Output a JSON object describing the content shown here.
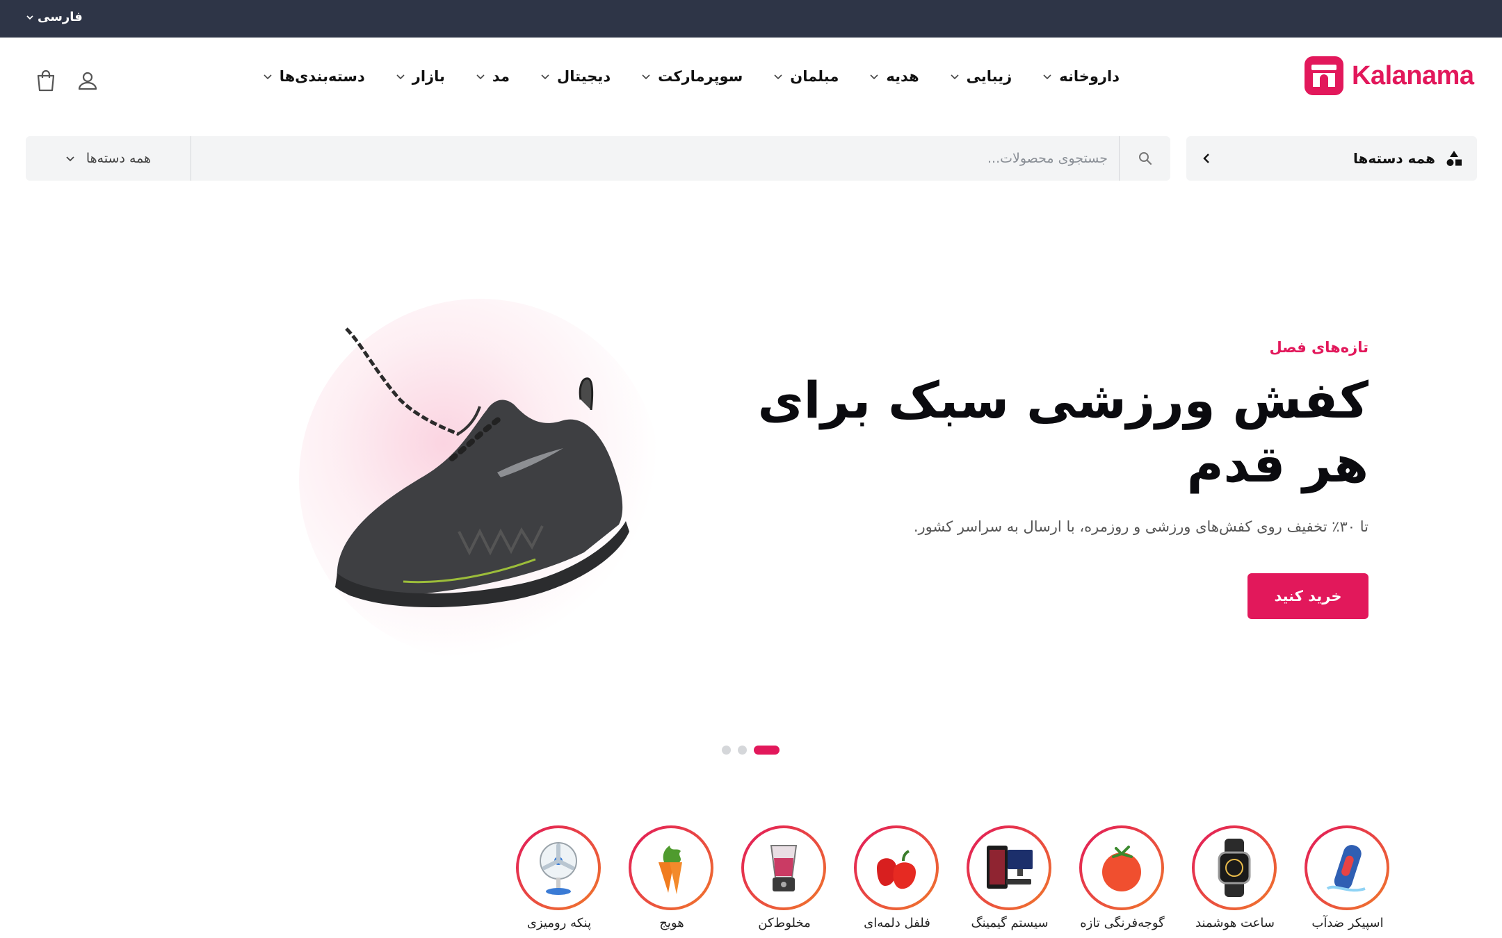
{
  "topbar": {
    "language": "فارسی"
  },
  "brand": {
    "name": "Kalanama",
    "color": "#e2185b"
  },
  "nav": {
    "items": [
      {
        "label": "دسته‌بندی‌ها"
      },
      {
        "label": "بازار"
      },
      {
        "label": "مد"
      },
      {
        "label": "دیجیتال"
      },
      {
        "label": "سوپرمارکت"
      },
      {
        "label": "مبلمان"
      },
      {
        "label": "هدیه"
      },
      {
        "label": "زیبایی"
      },
      {
        "label": "داروخانه"
      }
    ]
  },
  "header_icons": {
    "account": "user-icon",
    "cart": "shopping-bag-icon"
  },
  "search": {
    "all_categories_label": "همه دسته‌ها",
    "placeholder": "جستجوی محصولات...",
    "category_select": "همه دسته‌ها"
  },
  "hero": {
    "eyebrow": "تازه‌های فصل",
    "headline": "کفش ورزشی سبک برای هر قدم",
    "subtitle": "تا ۳۰٪ تخفیف روی کفش‌های ورزشی و روزمره، با ارسال به سراسر کشور.",
    "cta": "خرید کنید",
    "slides_total": 3,
    "active_slide": 1
  },
  "categories": [
    {
      "label": "اسپیکر ضدآب",
      "icon": "speaker-icon"
    },
    {
      "label": "ساعت هوشمند",
      "icon": "smartwatch-icon"
    },
    {
      "label": "گوجه‌فرنگی تازه",
      "icon": "tomato-icon"
    },
    {
      "label": "سیستم گیمینگ",
      "icon": "gaming-pc-icon"
    },
    {
      "label": "فلفل دلمه‌ای",
      "icon": "bell-pepper-icon"
    },
    {
      "label": "مخلوط‌کن",
      "icon": "blender-icon"
    },
    {
      "label": "هویج",
      "icon": "carrot-icon"
    },
    {
      "label": "پنکه رومیزی",
      "icon": "desk-fan-icon"
    }
  ]
}
